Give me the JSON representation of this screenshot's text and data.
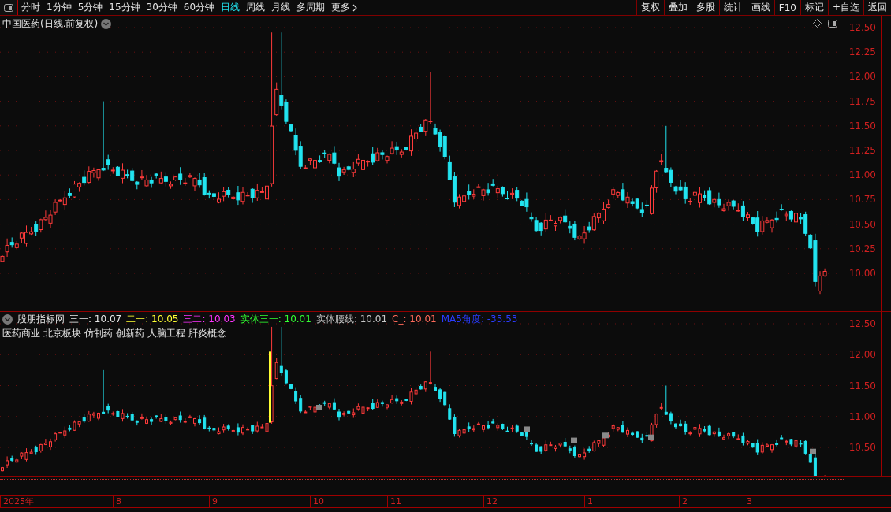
{
  "toolbar": {
    "periods": [
      {
        "label": "分时",
        "selected": false
      },
      {
        "label": "1分钟",
        "selected": false
      },
      {
        "label": "5分钟",
        "selected": false
      },
      {
        "label": "15分钟",
        "selected": false
      },
      {
        "label": "30分钟",
        "selected": false
      },
      {
        "label": "60分钟",
        "selected": false
      },
      {
        "label": "日线",
        "selected": true
      },
      {
        "label": "周线",
        "selected": false
      },
      {
        "label": "月线",
        "selected": false
      },
      {
        "label": "多周期",
        "selected": false
      }
    ],
    "more": "更多",
    "actions": [
      "复权",
      "叠加",
      "多股",
      "统计",
      "画线",
      "F10",
      "标记",
      "+自选",
      "返回"
    ]
  },
  "main_chart": {
    "title": "中国医药(日线.前复权)",
    "price_ticks": [
      "12.50",
      "12.25",
      "12.00",
      "11.75",
      "11.50",
      "11.25",
      "11.00",
      "10.75",
      "10.50",
      "10.25",
      "10.00"
    ]
  },
  "indicator_panel": {
    "name": "股朋指标网",
    "readouts": [
      {
        "text": "三一: 10.07",
        "color": "#e6e6e6"
      },
      {
        "text": "二一: 10.05",
        "color": "#ffff33"
      },
      {
        "text": "三二: 10.03",
        "color": "#ff33ff"
      },
      {
        "text": "实体三一: 10.01",
        "color": "#33ff33"
      },
      {
        "text": "实体腰线: 10.01",
        "color": "#c8c8c8"
      },
      {
        "text": "C_: 10.01",
        "color": "#ff6a5a"
      },
      {
        "text": "MA5角度: -35.53",
        "color": "#2a3cff"
      }
    ],
    "concepts": [
      "医药商业",
      "北京板块",
      "仿制药",
      "创新药",
      "人脑工程",
      "肝炎概念"
    ],
    "price_ticks": [
      "12.50",
      "12.00",
      "11.50",
      "11.00",
      "10.50"
    ]
  },
  "date_axis": {
    "labels": [
      "2025年",
      "8",
      "9",
      "10",
      "11",
      "12",
      "1",
      "2",
      "3"
    ]
  }
}
